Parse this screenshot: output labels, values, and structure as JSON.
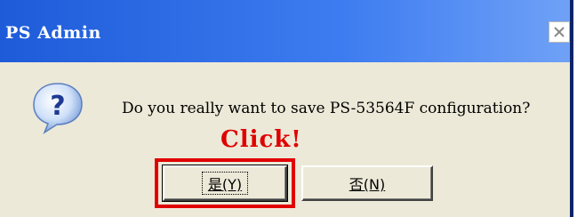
{
  "window": {
    "title": "PS Admin",
    "close_icon": "close-icon"
  },
  "dialog": {
    "icon": "question-icon",
    "message": "Do you really want to save PS-53564F configuration?",
    "annotation": "Click!",
    "buttons": {
      "yes_label": "是(Y)",
      "no_label": "否(N)"
    }
  },
  "colors": {
    "titlebar": "#1e5bd9",
    "dialog_bg": "#ece9d8",
    "annotation": "#e00000"
  }
}
